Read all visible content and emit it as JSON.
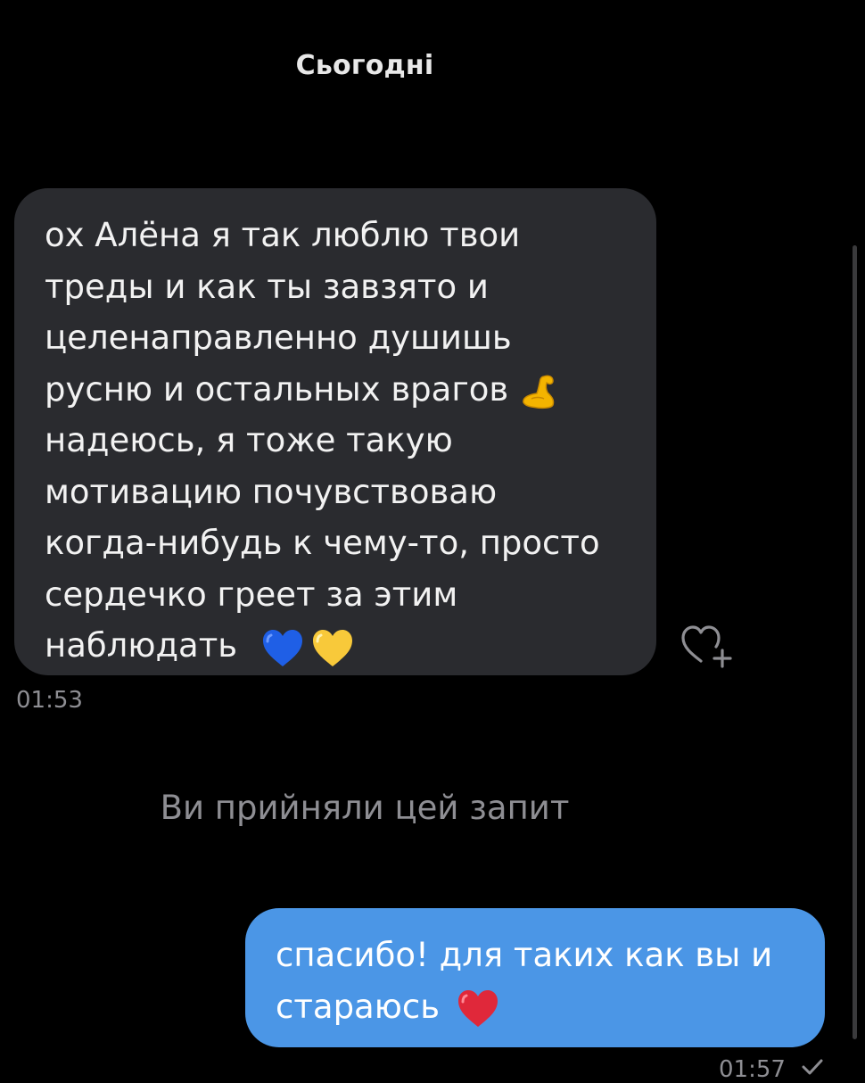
{
  "chat": {
    "date_header": "Сьогодні",
    "incoming_message": {
      "lines": [
        "ох Алёна я так люблю твои",
        "треды и как ты завзято и",
        "целенаправленно душишь",
        "русню и остальных врагов",
        "надеюсь, я тоже такую",
        "мотивацию почувствоваю",
        "когда-нибудь к чему-то, просто",
        "сердечко греет за этим",
        "наблюдать"
      ],
      "time": "01:53",
      "emoji": [
        "flexed-biceps-emoji",
        "blue-heart-emoji",
        "yellow-heart-emoji"
      ]
    },
    "system_message": "Ви прийняли цей запит",
    "outgoing_message": {
      "lines": [
        "спасибо! для таких как вы и",
        "стараюсь"
      ],
      "time": "01:57",
      "emoji": [
        "red-heart-emoji"
      ]
    },
    "react_icon": "heart-add-icon"
  },
  "colors": {
    "background": "#000000",
    "incoming_bubble": "#2a2b2f",
    "outgoing_bubble": "#4b96e6",
    "muted_text": "#8e8e93"
  }
}
